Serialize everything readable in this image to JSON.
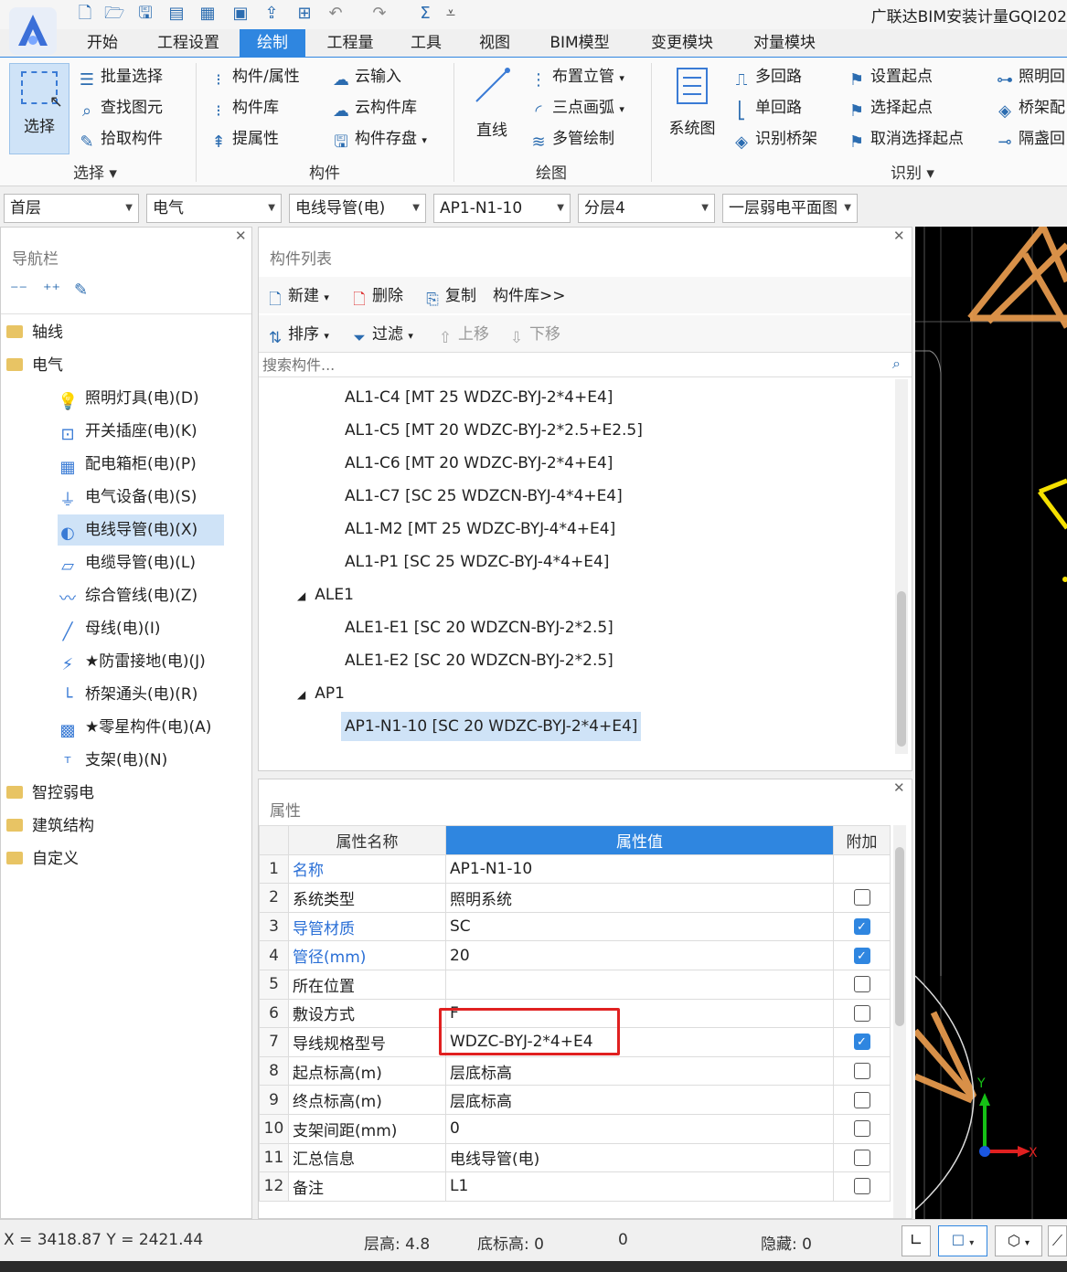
{
  "app": {
    "title": "广联达BIM安装计量GQI202",
    "menu_tabs": [
      "开始",
      "工程设置",
      "绘制",
      "工程量",
      "工具",
      "视图",
      "BIM模型",
      "变更模块",
      "对量模块"
    ],
    "active_tab": "绘制"
  },
  "ribbon": {
    "select_label": "选择",
    "select_group": {
      "items": [
        "批量选择",
        "查找图元",
        "拾取构件"
      ],
      "label": "选择"
    },
    "component_group": {
      "items": [
        "构件/属性",
        "构件库",
        "提属性",
        "云输入",
        "云构件库",
        "构件存盘"
      ],
      "label": "构件"
    },
    "draw_group": {
      "straight_line": "直线",
      "items": [
        "布置立管",
        "三点画弧",
        "多管绘制"
      ],
      "label": "绘图"
    },
    "identify_group": {
      "system_diagram": "系统图",
      "items": [
        "多回路",
        "单回路",
        "识别桥架",
        "设置起点",
        "选择起点",
        "取消选择起点",
        "照明回",
        "桥架配",
        "隔盏回"
      ],
      "label": "识别"
    }
  },
  "selectors": [
    "首层",
    "电气",
    "电线导管(电)",
    "AP1-N1-10",
    "分层4",
    "一层弱电平面图"
  ],
  "nav": {
    "title": "导航栏",
    "items": [
      {
        "label": "轴线",
        "type": "folder",
        "level": 0
      },
      {
        "label": "电气",
        "type": "folder-open",
        "level": 0
      },
      {
        "label": "照明灯具(电)(D)",
        "icon": "bulb-icon",
        "glyph": "💡",
        "level": 1
      },
      {
        "label": "开关插座(电)(K)",
        "icon": "switch-icon",
        "glyph": "⊡",
        "level": 1
      },
      {
        "label": "配电箱柜(电)(P)",
        "icon": "cabinet-icon",
        "glyph": "▦",
        "level": 1
      },
      {
        "label": "电气设备(电)(S)",
        "icon": "device-icon",
        "glyph": "⏚",
        "level": 1
      },
      {
        "label": "电线导管(电)(X)",
        "icon": "conduit-icon",
        "glyph": "◐",
        "level": 1,
        "selected": true
      },
      {
        "label": "电缆导管(电)(L)",
        "icon": "cable-icon",
        "glyph": "▱",
        "level": 1
      },
      {
        "label": "综合管线(电)(Z)",
        "icon": "pipeline-icon",
        "glyph": "〰",
        "level": 1
      },
      {
        "label": "母线(电)(I)",
        "icon": "busbar-icon",
        "glyph": "╱",
        "level": 1
      },
      {
        "label": "★防雷接地(电)(J)",
        "icon": "lightning-icon",
        "glyph": "⚡",
        "level": 1
      },
      {
        "label": "桥架通头(电)(R)",
        "icon": "tray-joint-icon",
        "glyph": "└",
        "level": 1
      },
      {
        "label": "★零星构件(电)(A)",
        "icon": "grid-icon",
        "glyph": "▩",
        "level": 1
      },
      {
        "label": "支架(电)(N)",
        "icon": "bracket-icon",
        "glyph": "ᵀ",
        "level": 1
      },
      {
        "label": "智控弱电",
        "type": "folder",
        "level": 0
      },
      {
        "label": "建筑结构",
        "type": "folder",
        "level": 0
      },
      {
        "label": "自定义",
        "type": "folder",
        "level": 0
      }
    ]
  },
  "component_list": {
    "title": "构件列表",
    "toolbar1": [
      "新建",
      "删除",
      "复制",
      "构件库>>"
    ],
    "toolbar2": [
      "排序",
      "过滤",
      "上移",
      "下移"
    ],
    "search_placeholder": "搜索构件...",
    "items": [
      {
        "label": "AL1-C4 [MT 25 WDZC-BYJ-2*4+E4]",
        "level": 2
      },
      {
        "label": "AL1-C5 [MT 20 WDZC-BYJ-2*2.5+E2.5]",
        "level": 2
      },
      {
        "label": "AL1-C6 [MT 20 WDZC-BYJ-2*4+E4]",
        "level": 2
      },
      {
        "label": "AL1-C7 [SC 25 WDZCN-BYJ-4*4+E4]",
        "level": 2
      },
      {
        "label": "AL1-M2 [MT 25 WDZC-BYJ-4*4+E4]",
        "level": 2
      },
      {
        "label": "AL1-P1 [SC 25 WDZC-BYJ-4*4+E4]",
        "level": 2
      },
      {
        "label": "ALE1",
        "level": 1,
        "expanded": true
      },
      {
        "label": "ALE1-E1 [SC 20 WDZCN-BYJ-2*2.5]",
        "level": 2
      },
      {
        "label": "ALE1-E2 [SC 20 WDZCN-BYJ-2*2.5]",
        "level": 2
      },
      {
        "label": "AP1",
        "level": 1,
        "expanded": true
      },
      {
        "label": "AP1-N1-10 [SC 20 WDZC-BYJ-2*4+E4]",
        "level": 2,
        "selected": true
      }
    ]
  },
  "properties": {
    "title": "属性",
    "headers": [
      "属性名称",
      "属性值",
      "附加"
    ],
    "rows": [
      {
        "num": "1",
        "name": "名称",
        "value": "AP1-N1-10",
        "blue": true,
        "check": null
      },
      {
        "num": "2",
        "name": "系统类型",
        "value": "照明系统",
        "blue": false,
        "check": false
      },
      {
        "num": "3",
        "name": "导管材质",
        "value": "SC",
        "blue": true,
        "check": true
      },
      {
        "num": "4",
        "name": "管径(mm)",
        "value": "20",
        "blue": true,
        "check": true
      },
      {
        "num": "5",
        "name": "所在位置",
        "value": "",
        "blue": false,
        "check": false
      },
      {
        "num": "6",
        "name": "敷设方式",
        "value": "F",
        "blue": false,
        "check": false
      },
      {
        "num": "7",
        "name": "导线规格型号",
        "value": "WDZC-BYJ-2*4+E4",
        "blue": false,
        "check": true
      },
      {
        "num": "8",
        "name": "起点标高(m)",
        "value": "层底标高",
        "blue": false,
        "check": false
      },
      {
        "num": "9",
        "name": "终点标高(m)",
        "value": "层底标高",
        "blue": false,
        "check": false
      },
      {
        "num": "10",
        "name": "支架间距(mm)",
        "value": "0",
        "blue": false,
        "check": false
      },
      {
        "num": "11",
        "name": "汇总信息",
        "value": "电线导管(电)",
        "blue": false,
        "check": false
      },
      {
        "num": "12",
        "name": "备注",
        "value": "L1",
        "blue": false,
        "check": false
      }
    ]
  },
  "status": {
    "coords": "X = 3418.87 Y = 2421.44",
    "floor_height": "层高: 4.8",
    "base_elev": "底标高: 0",
    "zero": "0",
    "hidden": "隐藏: 0"
  },
  "axes": {
    "x": "X",
    "y": "Y"
  },
  "colors": {
    "accent": "#2f86e0",
    "highlight": "#e02020",
    "model_orange": "#f0a050",
    "model_yellow": "#f5e000"
  }
}
